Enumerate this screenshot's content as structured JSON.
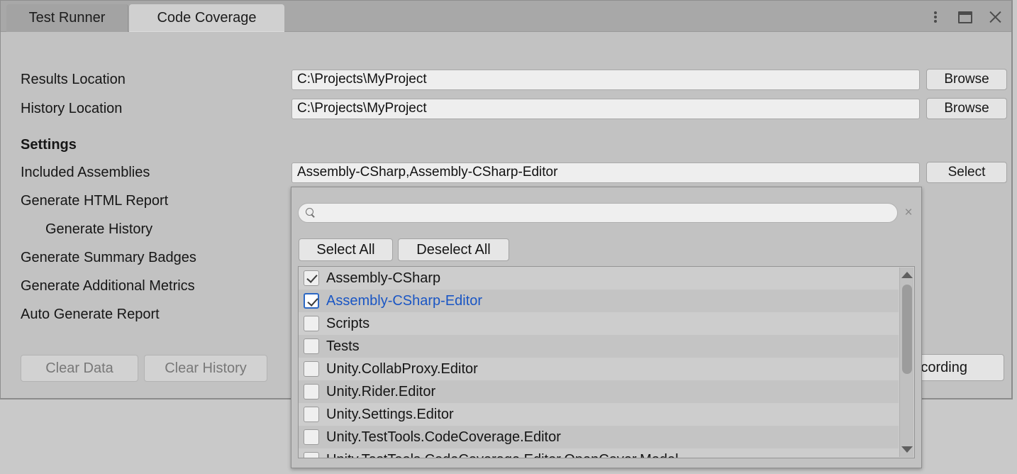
{
  "window": {
    "tabs": [
      {
        "label": "Test Runner",
        "active": false
      },
      {
        "label": "Code Coverage",
        "active": true
      }
    ],
    "controls": {
      "menu": "kebab-menu-icon",
      "maximize": "maximize-icon",
      "close": "close-icon"
    }
  },
  "form": {
    "results_location": {
      "label": "Results Location",
      "value": "C:\\Projects\\MyProject",
      "button": "Browse"
    },
    "history_location": {
      "label": "History Location",
      "value": "C:\\Projects\\MyProject",
      "button": "Browse"
    },
    "settings_header": "Settings",
    "included_assemblies": {
      "label": "Included Assemblies",
      "value": "Assembly-CSharp,Assembly-CSharp-Editor",
      "button": "Select"
    },
    "toggles": [
      {
        "label": "Generate HTML Report",
        "indent": false
      },
      {
        "label": "Generate History",
        "indent": true
      },
      {
        "label": "Generate Summary Badges",
        "indent": false
      },
      {
        "label": "Generate Additional Metrics",
        "indent": false
      },
      {
        "label": "Auto Generate Report",
        "indent": false
      }
    ],
    "buttons": {
      "clear_data": "Clear Data",
      "clear_history": "Clear History",
      "start_recording": "Start Recording"
    }
  },
  "dropdown": {
    "search": {
      "value": "",
      "placeholder": "",
      "icon": "search-icon",
      "clear": "×"
    },
    "select_all": "Select All",
    "deselect_all": "Deselect All",
    "items": [
      {
        "label": "Assembly-CSharp",
        "checked": true,
        "focused": false
      },
      {
        "label": "Assembly-CSharp-Editor",
        "checked": true,
        "focused": true
      },
      {
        "label": "Scripts",
        "checked": false,
        "focused": false
      },
      {
        "label": "Tests",
        "checked": false,
        "focused": false
      },
      {
        "label": "Unity.CollabProxy.Editor",
        "checked": false,
        "focused": false
      },
      {
        "label": "Unity.Rider.Editor",
        "checked": false,
        "focused": false
      },
      {
        "label": "Unity.Settings.Editor",
        "checked": false,
        "focused": false
      },
      {
        "label": "Unity.TestTools.CodeCoverage.Editor",
        "checked": false,
        "focused": false
      },
      {
        "label": "Unity.TestTools.CodeCoverage.Editor.OpenCover.Model",
        "checked": false,
        "focused": false
      }
    ]
  },
  "colors": {
    "window_bg": "#c2c2c2",
    "tab_active": "#d0d0d0",
    "tab_inactive": "#a3a3a3",
    "field_bg": "#eeeeee",
    "accent_blue": "#1A56C4",
    "focus_border": "#2C68C4",
    "row_odd": "#cdcdcd",
    "row_even": "#c4c4c4",
    "disabled_text": "#787878"
  }
}
